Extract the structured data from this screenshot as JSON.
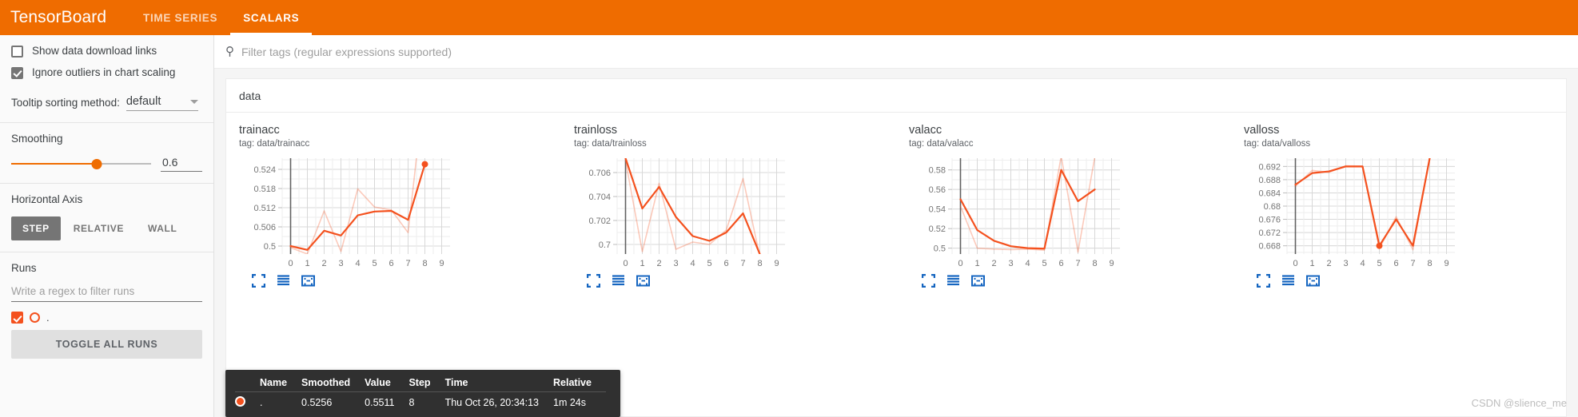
{
  "header": {
    "brand": "TensorBoard",
    "tabs": [
      {
        "label": "TIME SERIES",
        "active": false
      },
      {
        "label": "SCALARS",
        "active": true
      }
    ],
    "accent_color": "#ef6c00"
  },
  "sidebar": {
    "show_download_links": {
      "label": "Show data download links",
      "checked": false
    },
    "ignore_outliers": {
      "label": "Ignore outliers in chart scaling",
      "checked": true
    },
    "tooltip_sorting": {
      "label": "Tooltip sorting method:",
      "value": "default"
    },
    "smoothing": {
      "label": "Smoothing",
      "value": "0.6",
      "percent": 61
    },
    "horizontal_axis": {
      "label": "Horizontal Axis",
      "options": [
        "STEP",
        "RELATIVE",
        "WALL"
      ],
      "selected": "STEP"
    },
    "runs": {
      "label": "Runs",
      "filter_placeholder": "Write a regex to filter runs",
      "items": [
        {
          "name": ".",
          "checked": true,
          "color": "#f4511e"
        }
      ],
      "toggle_all_label": "TOGGLE ALL RUNS"
    }
  },
  "search": {
    "placeholder": "Filter tags (regular expressions supported)",
    "value": ""
  },
  "card": {
    "title": "data"
  },
  "tooltip": {
    "columns": [
      "Name",
      "Smoothed",
      "Value",
      "Step",
      "Time",
      "Relative"
    ],
    "rows": [
      {
        "color": "#f4511e",
        "name": ".",
        "smoothed": "0.5256",
        "value": "0.5511",
        "step": "8",
        "time": "Thu Oct 26, 20:34:13",
        "relative": "1m 24s"
      }
    ]
  },
  "watermark": "CSDN @slience_me",
  "chart_data": [
    {
      "type": "line",
      "title": "trainacc",
      "tag": "tag: data/trainacc",
      "xlabel": "",
      "ylabel": "",
      "xticks": [
        0,
        1,
        2,
        3,
        4,
        5,
        6,
        7,
        8,
        9
      ],
      "yticks": [
        0.5,
        0.506,
        0.512,
        0.518,
        0.524
      ],
      "xlim": [
        -0.5,
        9.5
      ],
      "ylim": [
        0.4975,
        0.5275
      ],
      "grid": true,
      "series": [
        {
          "name": "smoothed",
          "opacity": 1,
          "x": [
            0,
            1,
            2,
            3,
            4,
            5,
            6,
            7,
            8
          ],
          "values": [
            0.5,
            0.4988,
            0.5048,
            0.5033,
            0.5096,
            0.5108,
            0.511,
            0.5082,
            0.5256
          ]
        },
        {
          "name": "raw",
          "opacity": 0.3,
          "x": [
            0,
            1,
            2,
            3,
            4,
            5,
            6,
            7,
            8
          ],
          "values": [
            0.4995,
            0.4975,
            0.511,
            0.4983,
            0.5179,
            0.5122,
            0.5113,
            0.5042,
            0.5511
          ]
        }
      ],
      "marker": {
        "x": 8,
        "y": 0.5256
      }
    },
    {
      "type": "line",
      "title": "trainloss",
      "tag": "tag: data/trainloss",
      "xticks": [
        0,
        1,
        2,
        3,
        4,
        5,
        6,
        7,
        8,
        9
      ],
      "yticks": [
        0.7,
        0.702,
        0.704,
        0.706
      ],
      "xlim": [
        -0.5,
        9.5
      ],
      "ylim": [
        0.6992,
        0.7072
      ],
      "grid": true,
      "series": [
        {
          "name": "smoothed",
          "opacity": 1,
          "x": [
            0,
            1,
            2,
            3,
            4,
            5,
            6,
            7,
            8
          ],
          "values": [
            0.7072,
            0.703,
            0.7048,
            0.7023,
            0.7007,
            0.7003,
            0.701,
            0.7026,
            0.6992
          ]
        },
        {
          "name": "raw",
          "opacity": 0.3,
          "x": [
            0,
            1,
            2,
            3,
            4,
            5,
            6,
            7,
            8
          ],
          "values": [
            0.707,
            0.6994,
            0.7051,
            0.6996,
            0.7002,
            0.7,
            0.7012,
            0.7055,
            0.699
          ]
        }
      ]
    },
    {
      "type": "line",
      "title": "valacc",
      "tag": "tag: data/valacc",
      "xticks": [
        0,
        1,
        2,
        3,
        4,
        5,
        6,
        7,
        8,
        9
      ],
      "yticks": [
        0.5,
        0.52,
        0.54,
        0.56,
        0.58
      ],
      "xlim": [
        -0.5,
        9.5
      ],
      "ylim": [
        0.494,
        0.592
      ],
      "grid": true,
      "series": [
        {
          "name": "smoothed",
          "opacity": 1,
          "x": [
            0,
            1,
            2,
            3,
            4,
            5,
            6,
            7,
            8
          ],
          "values": [
            0.55,
            0.5185,
            0.5075,
            0.502,
            0.5,
            0.4995,
            0.58,
            0.548,
            0.56
          ]
        },
        {
          "name": "raw",
          "opacity": 0.3,
          "x": [
            0,
            1,
            2,
            3,
            4,
            5,
            6,
            7,
            8
          ],
          "values": [
            0.543,
            0.5,
            0.499,
            0.4985,
            0.499,
            0.498,
            0.594,
            0.496,
            0.593
          ]
        }
      ]
    },
    {
      "type": "line",
      "title": "valloss",
      "tag": "tag: data/valloss",
      "xticks": [
        0,
        1,
        2,
        3,
        4,
        5,
        6,
        7,
        8,
        9
      ],
      "yticks": [
        0.668,
        0.672,
        0.676,
        0.68,
        0.684,
        0.688,
        0.692
      ],
      "xlim": [
        -0.5,
        9.5
      ],
      "ylim": [
        0.6655,
        0.6945
      ],
      "grid": true,
      "series": [
        {
          "name": "smoothed",
          "opacity": 1,
          "x": [
            0,
            1,
            2,
            3,
            4,
            5,
            6,
            7,
            8
          ],
          "values": [
            0.6865,
            0.69,
            0.6905,
            0.692,
            0.692,
            0.668,
            0.676,
            0.668,
            0.6945
          ]
        },
        {
          "name": "raw",
          "opacity": 0.3,
          "x": [
            0,
            1,
            2,
            3,
            4,
            5,
            6,
            7,
            8
          ],
          "values": [
            0.686,
            0.6908,
            0.6902,
            0.6922,
            0.6921,
            0.6672,
            0.6768,
            0.6668,
            0.6948
          ]
        }
      ],
      "marker": {
        "x": 5,
        "y": 0.668
      }
    }
  ]
}
